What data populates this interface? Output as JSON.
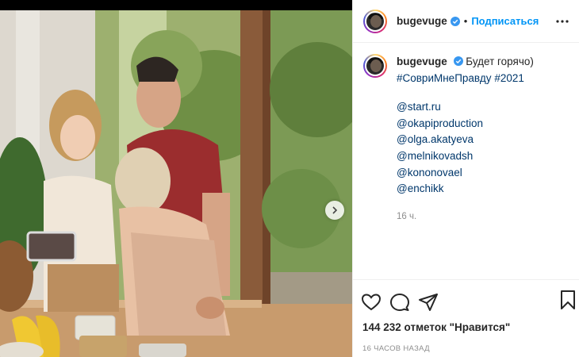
{
  "post": {
    "username": "bugevuge",
    "dot": "•",
    "follow_label": "Подписаться",
    "caption": {
      "username": "bugevuge",
      "text": "Будет горячо)",
      "hashtags": "#СовриМнеПравду #2021",
      "mentions": [
        "@start.ru",
        "@okapiproduction",
        "@olga.akatyeva",
        "@melnikovadsh",
        "@kononovael",
        "@enchikk"
      ],
      "time": "16 ч."
    },
    "likes": "144 232 отметок \"Нравится\"",
    "time_ago": "16 часов назад"
  },
  "icons": {
    "verified": "verified-badge-icon",
    "more": "more-horizontal-icon",
    "like": "heart-icon",
    "comment": "comment-icon",
    "share": "paper-plane-icon",
    "save": "bookmark-icon",
    "next": "chevron-right-icon"
  },
  "colors": {
    "link_blue": "#0095f6",
    "hashtag_blue": "#00376b",
    "muted": "#8e8e8e",
    "text": "#262626"
  }
}
